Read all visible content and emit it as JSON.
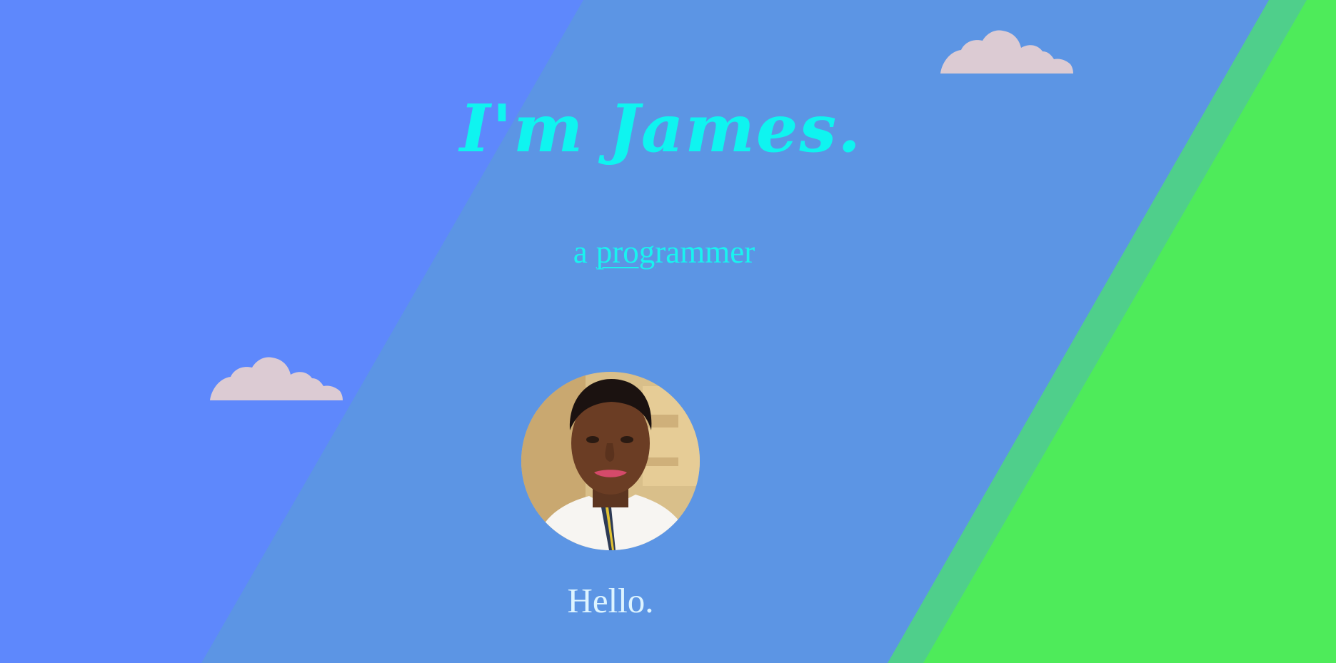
{
  "hero": {
    "title": "I'm James.",
    "subtitle_prefix": "a",
    "subtitle_underlined": "prog",
    "subtitle_rest": "rammer",
    "greeting": "Hello."
  },
  "colors": {
    "sky_left": "#5e88fc",
    "sky_band": "#5c95e4",
    "stripe": "#4fcf8b",
    "grass": "#4eeb5a",
    "cloud": "#dccbd3",
    "title": "#0ff4f0",
    "greeting": "#ddf4ff"
  },
  "icons": {
    "cloud_top": "cloud-icon",
    "cloud_left": "cloud-icon",
    "avatar": "profile-photo"
  }
}
